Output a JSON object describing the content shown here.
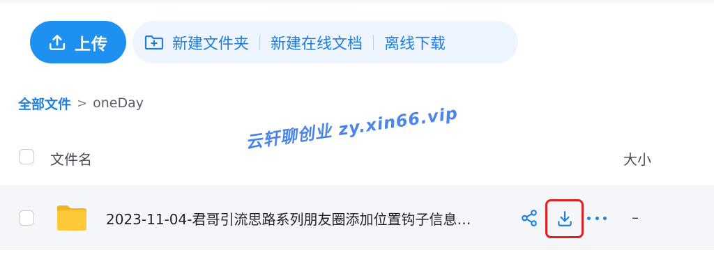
{
  "toolbar": {
    "upload_label": "上传",
    "actions": [
      {
        "label": "新建文件夹",
        "icon": "folder-add-icon"
      },
      {
        "label": "新建在线文档",
        "icon": null
      },
      {
        "label": "离线下载",
        "icon": null
      }
    ]
  },
  "breadcrumb": {
    "root": "全部文件",
    "separator": ">",
    "current": "oneDay"
  },
  "table": {
    "columns": {
      "name": "文件名",
      "size": "大小"
    },
    "rows": [
      {
        "name": "2023-11-04-君哥引流思路系列朋友圈添加位置钩子信息…",
        "size": "–",
        "type": "folder",
        "icon": "folder-icon",
        "highlighted_action": "download"
      }
    ]
  },
  "watermark": "云轩聊创业  zy.xin66.vip",
  "colors": {
    "primary": "#1e90ef",
    "primary_text": "#1e7fde",
    "action_bg": "#eef5fe",
    "row_bg": "#f5f6f9",
    "highlight_border": "#e02020",
    "folder": "#ffc93a"
  }
}
